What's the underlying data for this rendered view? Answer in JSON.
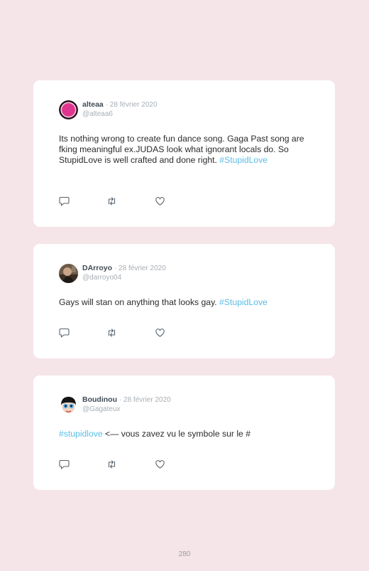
{
  "tweets": [
    {
      "name": "alteaa",
      "date": "· 28 février 2020",
      "handle": "@alteaa6",
      "text": "Its nothing wrong to create fun dance song. Gaga Past song are fking meaningful ex.JUDAS look what ignorant locals do. So StupidLove is well crafted and done right.",
      "hashtag": "#StupidLove",
      "avatar_icon": "magenta-circle-avatar"
    },
    {
      "name": "DArroyo",
      "date": "· 28 février 2020",
      "handle": "@darroyo04",
      "text": "Gays will stan on anything that looks gay. ",
      "hashtag": "#StupidLove",
      "avatar_icon": "profile-photo-avatar"
    },
    {
      "name": "Boudinou",
      "date": "· 28 février 2020",
      "handle": "@Gagateux",
      "hashtag": "#stupidlove",
      "text": " <— vous zavez vu le symbole sur le #",
      "avatar_icon": "cartoon-face-avatar"
    }
  ],
  "icons": {
    "reply": "reply-icon",
    "retweet": "retweet-icon",
    "like": "heart-icon"
  },
  "colors": {
    "background": "#f5e4e8",
    "hashtag": "#5bbde4",
    "username": "#3f4a55",
    "muted": "#a8aeb4"
  },
  "page_number": "280"
}
